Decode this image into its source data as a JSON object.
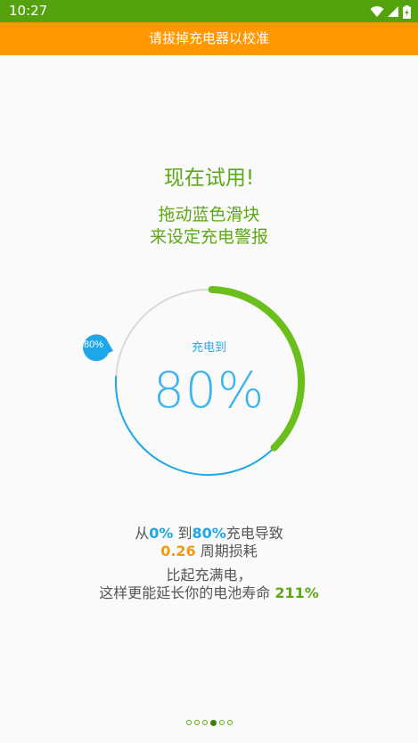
{
  "status_bar": {
    "time": "10:27",
    "icons": [
      "wifi-icon",
      "signal-icon",
      "battery-charging-icon"
    ],
    "color": "#55a20f"
  },
  "banner": {
    "text": "请拔掉充电器以校准",
    "color": "#ff9800"
  },
  "intro": {
    "title": "现在试用!",
    "line1": "拖动蓝色滑块",
    "line2": "来设定充电警报"
  },
  "dial": {
    "caption": "充电到",
    "value_label": "80%",
    "knob_label": "80%",
    "target_percent": 80,
    "colors": {
      "progress": "#6bbf1c",
      "track_blue": "#1ea7e8",
      "track_gray": "#d9d9d9",
      "knob": "#1ea7e8"
    }
  },
  "info": {
    "from_prefix": "从",
    "from_value": "0%",
    "to_prefix": " 到",
    "to_value": "80%",
    "from_to_suffix": "充电导致",
    "cycles_value": "0.26",
    "cycles_suffix": " 周期损耗",
    "compare_line": "比起充满电，",
    "extend_prefix": "这样更能延长你的电池寿命 ",
    "extend_value": "211%"
  },
  "pager": {
    "count": 6,
    "active_index": 3
  }
}
